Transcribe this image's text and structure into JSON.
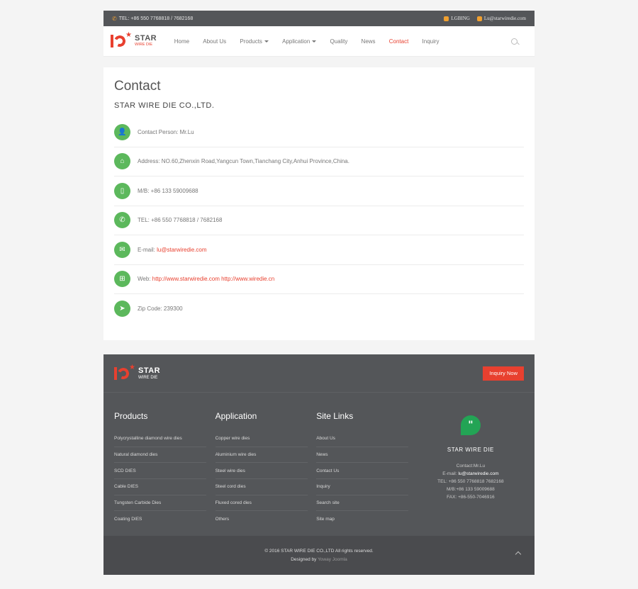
{
  "topbar": {
    "tel": "TEL: +86 550 7768818 / 7682168",
    "skype": "LGBING",
    "email": "Lu@starwiredie.com"
  },
  "brand": {
    "name": "STAR",
    "sub": "WIRE DIE"
  },
  "nav": [
    {
      "label": "Home"
    },
    {
      "label": "About Us"
    },
    {
      "label": "Products",
      "dropdown": true
    },
    {
      "label": "Application",
      "dropdown": true
    },
    {
      "label": "Quality"
    },
    {
      "label": "News"
    },
    {
      "label": "Contact",
      "active": true
    },
    {
      "label": "Inquiry"
    }
  ],
  "contact": {
    "title": "Contact",
    "company": "STAR WIRE DIE CO.,LTD.",
    "rows": [
      {
        "icon": "user-icon",
        "text": "Contact Person: Mr.Lu",
        "link": ""
      },
      {
        "icon": "home-icon",
        "text": "Address: NO.60,Zhenxin Road,Yangcun Town,Tianchang City,Anhui Province,China.",
        "link": ""
      },
      {
        "icon": "mobile-icon",
        "text": "M/B: +86 133 59009688",
        "link": ""
      },
      {
        "icon": "phone-icon",
        "text": "TEL: +86 550 7768818 / 7682168",
        "link": ""
      },
      {
        "icon": "envelope-icon",
        "text": "E-mail: ",
        "link": "lu@starwiredie.com"
      },
      {
        "icon": "sitemap-icon",
        "text": "Web: ",
        "link": "http://www.starwiredie.com http://www.wiredie.cn"
      },
      {
        "icon": "send-icon",
        "text": "Zip Code: 239300",
        "link": ""
      }
    ]
  },
  "footer": {
    "inquiry_button": "Inquiry Now",
    "columns": [
      {
        "title": "Products",
        "items": [
          "Polycrystalline diamond wire dies",
          "Natural diamond dies",
          "SCD DIES",
          "Cable DIES",
          "Tungsten Carbide Dies",
          "Coating DIES"
        ]
      },
      {
        "title": "Application",
        "items": [
          "Copper wire dies",
          "Aluminium wire dies",
          "Steel wire dies",
          "Steel cord dies",
          "Fluxed cored dies",
          "Others"
        ]
      },
      {
        "title": "Site Links",
        "items": [
          "About Us",
          "News",
          "Contact Us",
          "Inquiry",
          "Search site",
          "Site map"
        ]
      }
    ],
    "card": {
      "name": "STAR WIRE DIE",
      "contact": "Contact:Mr.Lu",
      "email_label": "E-mail: ",
      "email": "lu@starwiredie.com",
      "tel": "TEL: +86 550 7768818 7682168",
      "mb": "M/B:+86 133 59009688",
      "fax": "FAX: +86-550-7046916"
    },
    "copyright": "© 2016 STAR WIRE DIE CO.,LTD All rights reserved.",
    "designed_by": "Designed by ",
    "designer": "Yoway Joomla"
  },
  "colors": {
    "accent": "#e8402f",
    "green": "#5cb85c",
    "footer_bg": "#545659"
  }
}
